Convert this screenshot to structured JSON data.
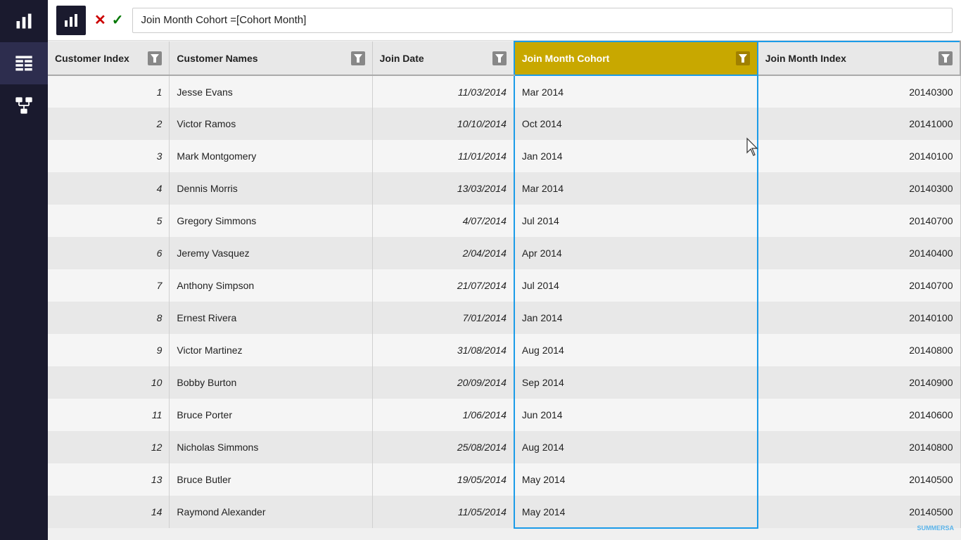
{
  "sidebar": {
    "icons": [
      {
        "name": "chart-bar-icon",
        "label": "Chart"
      },
      {
        "name": "table-icon",
        "label": "Table",
        "active": true
      },
      {
        "name": "diagram-icon",
        "label": "Diagram"
      }
    ]
  },
  "formula_bar": {
    "cancel_label": "✕",
    "confirm_label": "✓",
    "formula_text": "Join Month Cohort = [Cohort Month]",
    "formula_plain": "Join Month Cohort = ",
    "formula_bracket": "[Cohort Month]"
  },
  "table": {
    "columns": [
      {
        "label": "Customer Index",
        "key": "customer_index"
      },
      {
        "label": "Customer Names",
        "key": "customer_names"
      },
      {
        "label": "Join Date",
        "key": "join_date"
      },
      {
        "label": "Join Month Cohort",
        "key": "join_month_cohort",
        "highlighted": true
      },
      {
        "label": "Join Month Index",
        "key": "join_month_index"
      }
    ],
    "rows": [
      {
        "customer_index": "1",
        "customer_names": "Jesse Evans",
        "join_date": "11/03/2014",
        "join_month_cohort": "Mar 2014",
        "join_month_index": "20140300"
      },
      {
        "customer_index": "2",
        "customer_names": "Victor Ramos",
        "join_date": "10/10/2014",
        "join_month_cohort": "Oct 2014",
        "join_month_index": "20141000"
      },
      {
        "customer_index": "3",
        "customer_names": "Mark Montgomery",
        "join_date": "11/01/2014",
        "join_month_cohort": "Jan 2014",
        "join_month_index": "20140100"
      },
      {
        "customer_index": "4",
        "customer_names": "Dennis Morris",
        "join_date": "13/03/2014",
        "join_month_cohort": "Mar 2014",
        "join_month_index": "20140300"
      },
      {
        "customer_index": "5",
        "customer_names": "Gregory Simmons",
        "join_date": "4/07/2014",
        "join_month_cohort": "Jul 2014",
        "join_month_index": "20140700"
      },
      {
        "customer_index": "6",
        "customer_names": "Jeremy Vasquez",
        "join_date": "2/04/2014",
        "join_month_cohort": "Apr 2014",
        "join_month_index": "20140400"
      },
      {
        "customer_index": "7",
        "customer_names": "Anthony Simpson",
        "join_date": "21/07/2014",
        "join_month_cohort": "Jul 2014",
        "join_month_index": "20140700"
      },
      {
        "customer_index": "8",
        "customer_names": "Ernest Rivera",
        "join_date": "7/01/2014",
        "join_month_cohort": "Jan 2014",
        "join_month_index": "20140100"
      },
      {
        "customer_index": "9",
        "customer_names": "Victor Martinez",
        "join_date": "31/08/2014",
        "join_month_cohort": "Aug 2014",
        "join_month_index": "20140800"
      },
      {
        "customer_index": "10",
        "customer_names": "Bobby Burton",
        "join_date": "20/09/2014",
        "join_month_cohort": "Sep 2014",
        "join_month_index": "20140900"
      },
      {
        "customer_index": "11",
        "customer_names": "Bruce Porter",
        "join_date": "1/06/2014",
        "join_month_cohort": "Jun 2014",
        "join_month_index": "20140600"
      },
      {
        "customer_index": "12",
        "customer_names": "Nicholas Simmons",
        "join_date": "25/08/2014",
        "join_month_cohort": "Aug 2014",
        "join_month_index": "20140800"
      },
      {
        "customer_index": "13",
        "customer_names": "Bruce Butler",
        "join_date": "19/05/2014",
        "join_month_cohort": "May 2014",
        "join_month_index": "20140500"
      },
      {
        "customer_index": "14",
        "customer_names": "Raymond Alexander",
        "join_date": "11/05/2014",
        "join_month_cohort": "May 2014",
        "join_month_index": "20140500"
      }
    ]
  }
}
